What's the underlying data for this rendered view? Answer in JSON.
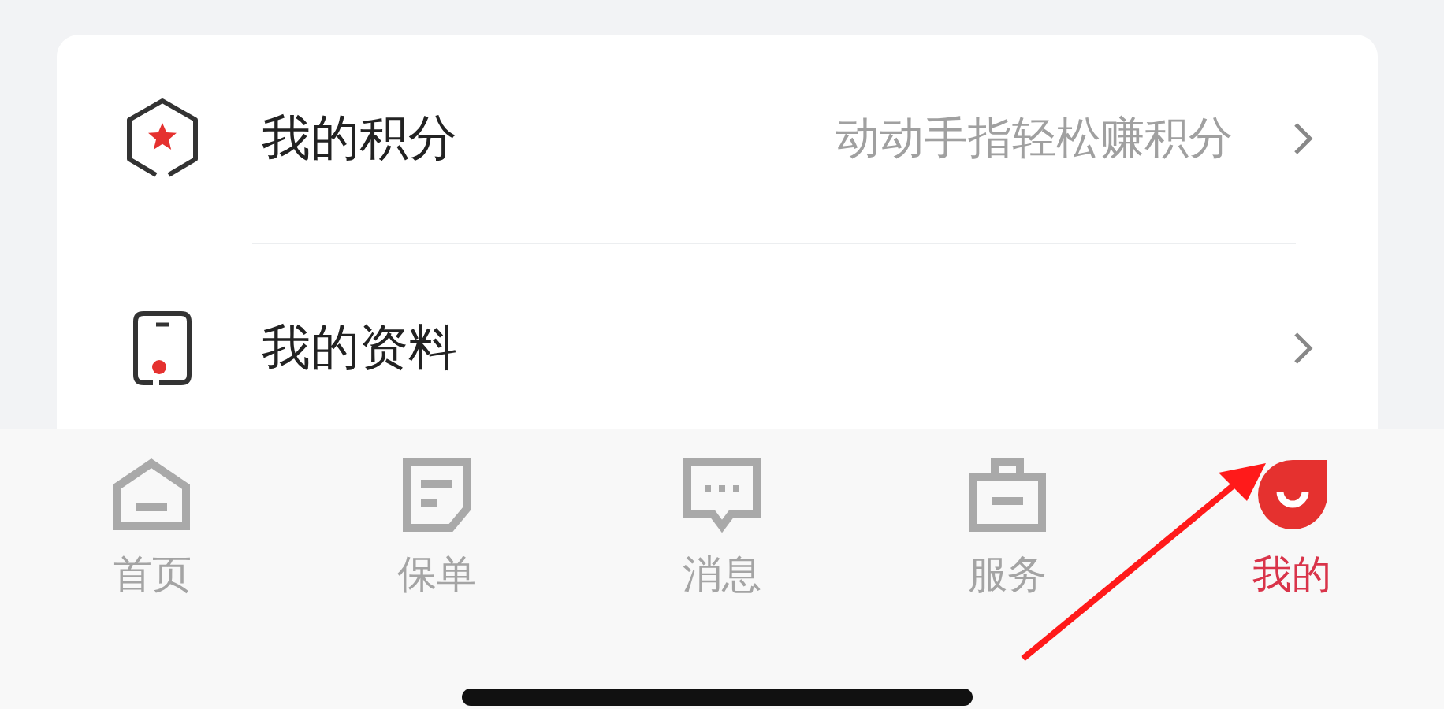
{
  "menu": [
    {
      "kind": "points",
      "label": "我的积分",
      "hint": "动动手指轻松赚积分"
    },
    {
      "kind": "profile",
      "label": "我的资料"
    }
  ],
  "tab_bar": [
    {
      "kind": "home",
      "label": "首页",
      "selected": false
    },
    {
      "kind": "policy",
      "label": "保单",
      "selected": false
    },
    {
      "kind": "message",
      "label": "消息",
      "selected": false
    },
    {
      "kind": "service",
      "label": "服务",
      "selected": false
    },
    {
      "kind": "me",
      "label": "我的",
      "selected": true
    }
  ]
}
